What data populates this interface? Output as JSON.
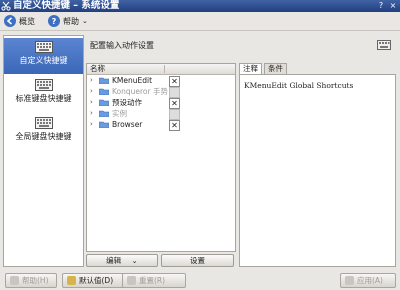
{
  "window": {
    "title": "自定义快捷键 – 系统设置",
    "controls": [
      "?",
      "×"
    ]
  },
  "toolbar": {
    "overview_label": "概览",
    "help_label": "帮助",
    "help_arrow": "⌄"
  },
  "sidebar": {
    "items": [
      {
        "label": "自定义快捷键"
      },
      {
        "label": "标准键盘快捷键"
      },
      {
        "label": "全局键盘快捷键"
      }
    ]
  },
  "main": {
    "heading": "配置输入动作设置",
    "tree": {
      "column_name": "名称",
      "rows": [
        {
          "name": "KMenuEdit",
          "checked": true,
          "disabled": false,
          "mark": "✕"
        },
        {
          "name": "Konqueror 手势",
          "checked": false,
          "disabled": true,
          "mark": ""
        },
        {
          "name": "预设动作",
          "checked": true,
          "disabled": false,
          "mark": "✕"
        },
        {
          "name": "实例",
          "checked": false,
          "disabled": true,
          "mark": ""
        },
        {
          "name": "Browser",
          "checked": true,
          "disabled": false,
          "mark": "✕"
        }
      ]
    },
    "edit_button": "编辑",
    "edit_arrow": "⌄",
    "settings_button": "设置",
    "tabs": [
      {
        "label": "注释",
        "active": true
      },
      {
        "label": "条件",
        "active": false
      }
    ],
    "comment_text": "KMenuEdit Global Shortcuts"
  },
  "bottom": {
    "help_button": "帮助(H)",
    "defaults_button": "默认值(D)",
    "reset_button": "重置(R)",
    "apply_button": "应用(A)"
  },
  "colors": {
    "titlebar": "#2f4f92",
    "selection": "#4a76c5",
    "folder": "#6a9be0"
  }
}
